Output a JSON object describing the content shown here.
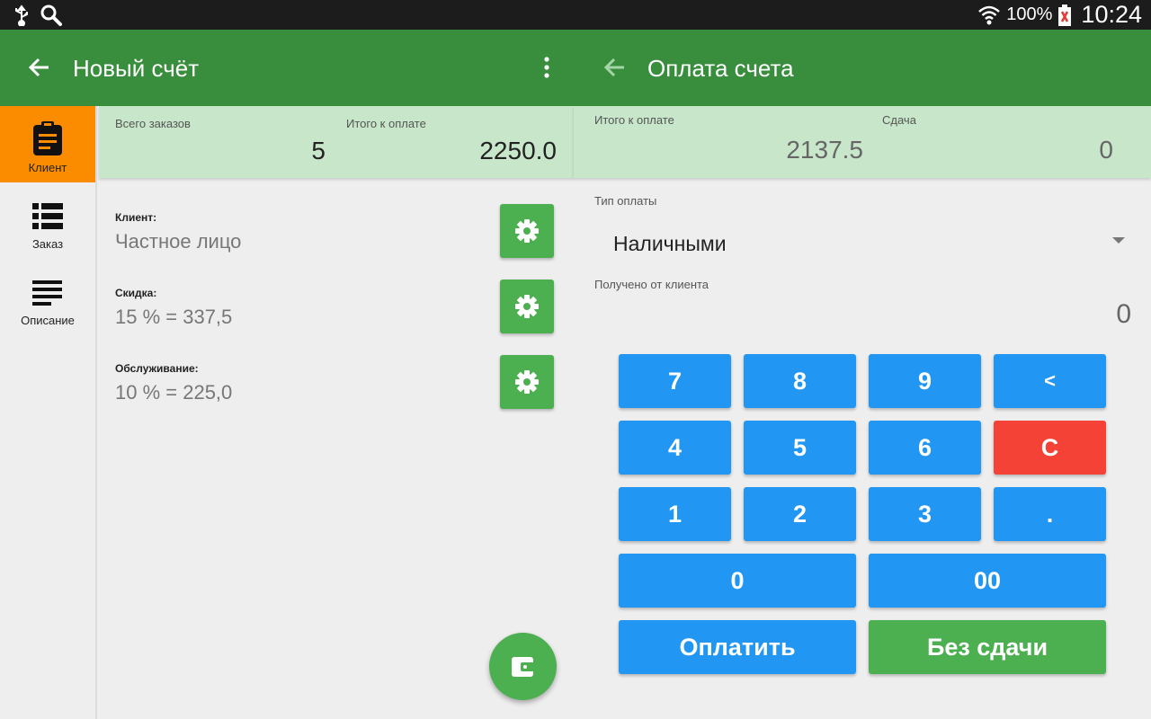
{
  "status_bar": {
    "battery_percent": "100%",
    "time": "10:24"
  },
  "left_panel": {
    "title": "Новый счёт",
    "summary": {
      "orders_label": "Всего заказов",
      "orders_value": "5",
      "total_label": "Итого к оплате",
      "total_value": "2250.0"
    },
    "nav": [
      {
        "label": "Клиент",
        "active": true
      },
      {
        "label": "Заказ",
        "active": false
      },
      {
        "label": "Описание",
        "active": false
      }
    ],
    "fields": [
      {
        "label": "Клиент:",
        "value": "Частное лицо"
      },
      {
        "label": "Скидка:",
        "value": "15 % = 337,5"
      },
      {
        "label": "Обслуживание:",
        "value": "10 % = 225,0"
      }
    ]
  },
  "right_panel": {
    "title": "Оплата счета",
    "summary": {
      "total_label": "Итого к оплате",
      "total_value": "2137.5",
      "change_label": "Сдача",
      "change_value": "0"
    },
    "payment_type_label": "Тип оплаты",
    "payment_type_value": "Наличными",
    "received_label": "Получено от клиента",
    "received_value": "0",
    "keypad": {
      "k7": "7",
      "k8": "8",
      "k9": "9",
      "backspace": "<",
      "k4": "4",
      "k5": "5",
      "k6": "6",
      "clear": "C",
      "k1": "1",
      "k2": "2",
      "k3": "3",
      "dot": ".",
      "k0": "0",
      "k00": "00",
      "pay": "Оплатить",
      "no_change": "Без сдачи"
    }
  },
  "colors": {
    "appbar": "#388e3c",
    "summary_bg": "#c8e6c9",
    "nav_active": "#fb8c00",
    "key_blue": "#2196f3",
    "key_red": "#f44336",
    "green_button": "#4caf50"
  }
}
